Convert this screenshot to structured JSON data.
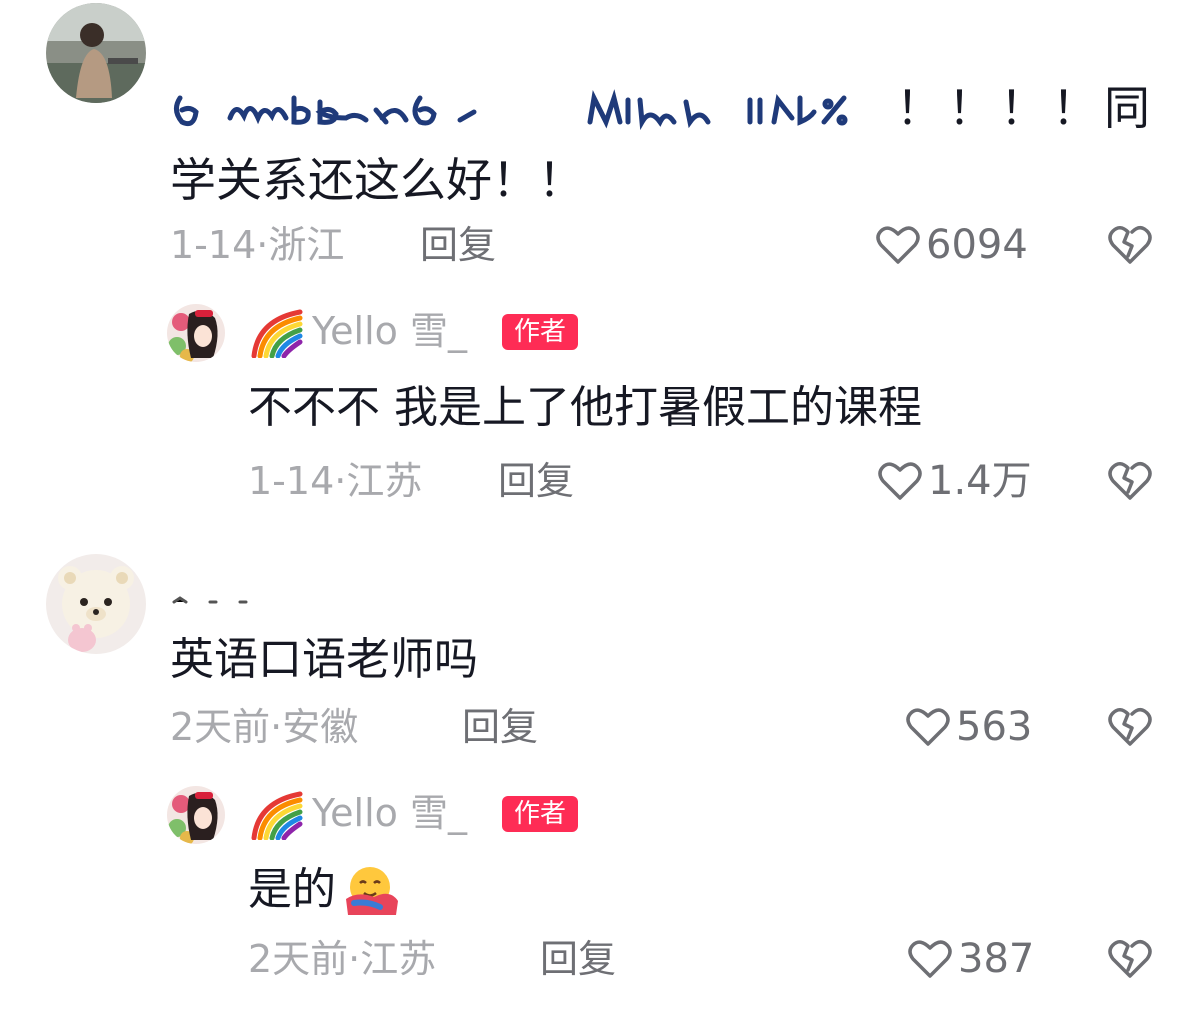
{
  "comments": [
    {
      "text_line1": "！！！！同",
      "text_line2": "学关系还这么好！！",
      "meta": "1-14·浙江",
      "reply_label": "回复",
      "likes": "6094",
      "replies": [
        {
          "username": "Yello 雪_",
          "badge": "作者",
          "text": "不不不 我是上了他打暑假工的课程",
          "meta": "1-14·江苏",
          "reply_label": "回复",
          "likes": "1.4万"
        }
      ]
    },
    {
      "text_line1": "英语口语老师吗",
      "meta": "2天前·安徽",
      "reply_label": "回复",
      "likes": "563",
      "replies": [
        {
          "username": "Yello 雪_",
          "badge": "作者",
          "text": "是的",
          "meta": "2天前·江苏",
          "reply_label": "回复",
          "likes": "387"
        }
      ]
    }
  ],
  "icons": {
    "like": "heart-outline-icon",
    "dislike": "broken-heart-icon",
    "emoji": "hug-emoji-icon",
    "rainbow": "rainbow-emoji-icon"
  },
  "colors": {
    "badge": "#fe2c55",
    "meta": "#a8a9ad",
    "text": "#161823"
  }
}
